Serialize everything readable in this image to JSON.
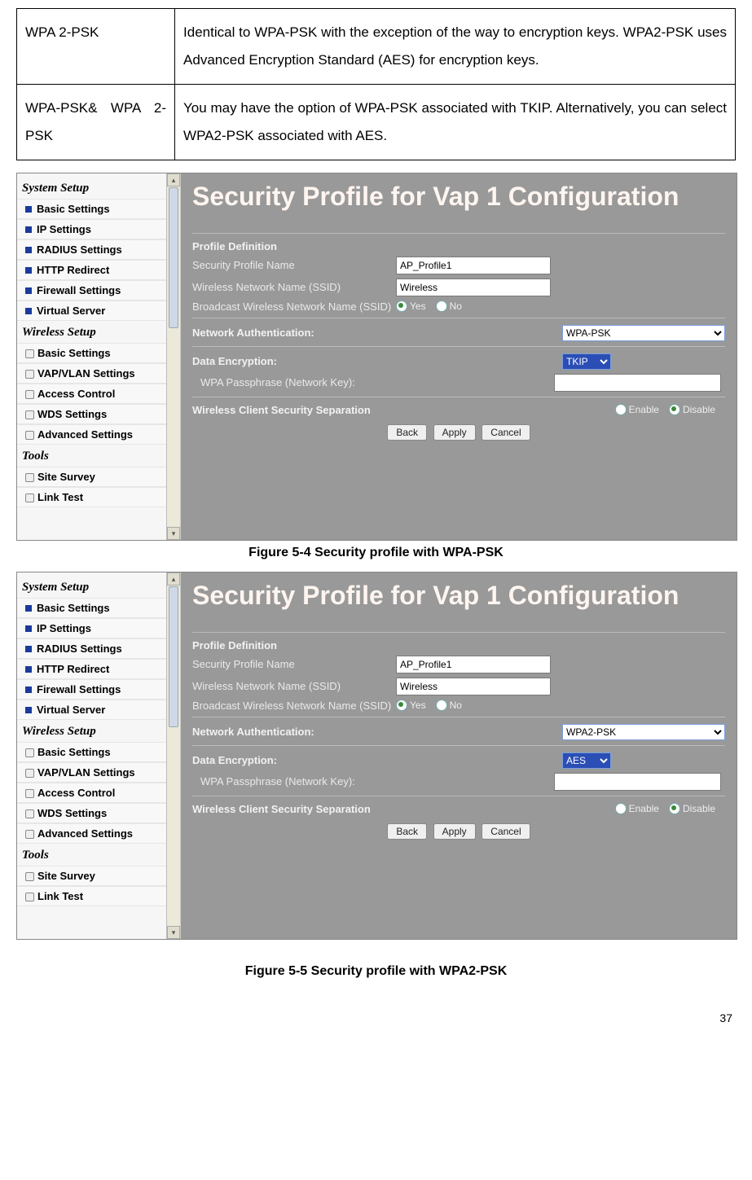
{
  "topTable": {
    "row1": {
      "c1": "WPA 2-PSK",
      "c2": "Identical to WPA-PSK with the exception of the way to encryption keys. WPA2-PSK uses Advanced Encryption Standard (AES) for encryption keys."
    },
    "row2": {
      "c1": "WPA-PSK& WPA 2-PSK",
      "c2": "You may have the option of WPA-PSK associated with TKIP. Alternatively, you can select WPA2-PSK associated with AES."
    }
  },
  "sidebar": {
    "systemTitle": "System Setup",
    "sysItems": [
      "Basic Settings",
      "IP Settings",
      "RADIUS Settings",
      "HTTP Redirect",
      "Firewall Settings",
      "Virtual Server"
    ],
    "wirelessTitle": "Wireless Setup",
    "wItems": [
      "Basic Settings",
      "VAP/VLAN Settings",
      "Access Control",
      "WDS Settings",
      "Advanced Settings"
    ],
    "toolsTitle": "Tools",
    "tItems": [
      "Site Survey",
      "Link Test"
    ]
  },
  "figA": {
    "heading": "Security Profile for Vap 1 Configuration",
    "profileDef": "Profile Definition",
    "profileNameLbl": "Security Profile Name",
    "profileNameVal": "AP_Profile1",
    "ssidLbl": "Wireless Network Name (SSID)",
    "ssidVal": "Wireless",
    "broadcastLbl": "Broadcast Wireless Network Name (SSID)",
    "yes": "Yes",
    "no": "No",
    "netAuthLbl": "Network Authentication:",
    "netAuthVal": "WPA-PSK",
    "dataEncLbl": "Data Encryption:",
    "dataEncVal": "TKIP",
    "passLbl": "WPA Passphrase (Network Key):",
    "sepLbl": "Wireless Client Security Separation",
    "enable": "Enable",
    "disable": "Disable",
    "back": "Back",
    "apply": "Apply",
    "cancel": "Cancel"
  },
  "figB": {
    "heading": "Security Profile for Vap 1 Configuration",
    "netAuthVal": "WPA2-PSK",
    "dataEncVal": "AES"
  },
  "captions": {
    "a": "Figure 5-4 Security profile with WPA-PSK",
    "b": "Figure 5-5 Security profile with WPA2-PSK"
  },
  "pageNum": "37"
}
